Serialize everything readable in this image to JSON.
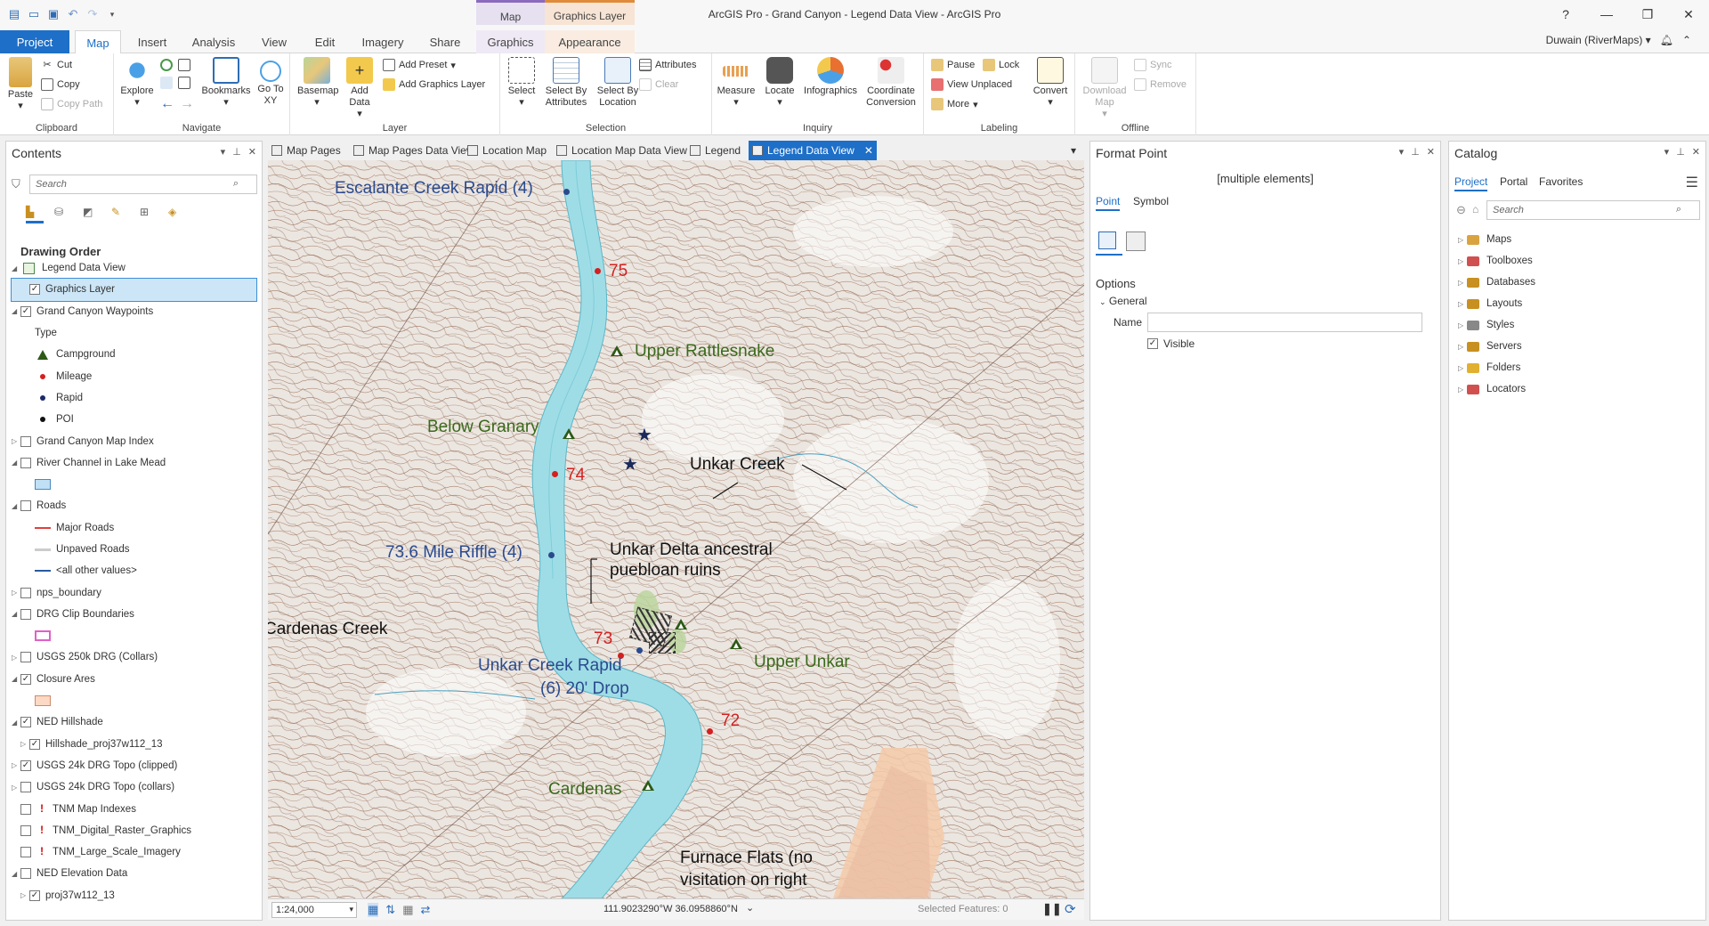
{
  "window": {
    "title": "ArcGIS Pro - Grand Canyon - Legend Data View - ArcGIS Pro",
    "controls": [
      "?",
      "—",
      "❐",
      "✕"
    ]
  },
  "context_tabs": {
    "map_header": "Map",
    "graphics_layer_header": "Graphics Layer",
    "graphics": "Graphics",
    "appearance": "Appearance"
  },
  "ribbon_tabs": [
    "Project",
    "Map",
    "Insert",
    "Analysis",
    "View",
    "Edit",
    "Imagery",
    "Share"
  ],
  "user": {
    "name": "Duwain (RiverMaps) ▾"
  },
  "ribbon": {
    "clipboard": {
      "label": "Clipboard",
      "paste": "Paste",
      "cut": "Cut",
      "copy": "Copy",
      "copy_path": "Copy Path"
    },
    "navigate": {
      "label": "Navigate",
      "explore": "Explore",
      "bookmarks": "Bookmarks",
      "go_to_xy": "Go To XY"
    },
    "layer": {
      "label": "Layer",
      "basemap": "Basemap",
      "add_data": "Add Data",
      "add_preset": "Add Preset",
      "add_graphics_layer": "Add Graphics Layer"
    },
    "selection": {
      "label": "Selection",
      "select": "Select",
      "select_by_attributes": "Select By Attributes",
      "select_by_location": "Select By Location",
      "attributes": "Attributes",
      "clear": "Clear"
    },
    "inquiry": {
      "label": "Inquiry",
      "measure": "Measure",
      "locate": "Locate",
      "infographics": "Infographics",
      "coordinate_conversion": "Coordinate Conversion"
    },
    "labeling": {
      "label": "Labeling",
      "pause": "Pause",
      "lock": "Lock",
      "view_unplaced": "View Unplaced",
      "more": "More",
      "convert": "Convert"
    },
    "offline": {
      "label": "Offline",
      "download_map": "Download Map",
      "sync": "Sync",
      "remove": "Remove"
    }
  },
  "contents": {
    "title": "Contents",
    "search_placeholder": "Search",
    "drawing_order": "Drawing Order",
    "items": [
      {
        "label": "Legend Data View",
        "kind": "map",
        "exp": "◢"
      },
      {
        "label": "Graphics Layer",
        "kind": "layer",
        "checked": true,
        "selected": true,
        "indent": 1
      },
      {
        "label": "Grand Canyon Waypoints",
        "kind": "layer",
        "checked": true,
        "exp": "◢",
        "indent": 0
      },
      {
        "label": "Type",
        "kind": "heading",
        "indent": 1
      },
      {
        "label": "Campground",
        "kind": "sym-camp",
        "indent": 1
      },
      {
        "label": "Mileage",
        "kind": "sym-red",
        "indent": 1
      },
      {
        "label": "Rapid",
        "kind": "sym-navy",
        "indent": 1
      },
      {
        "label": "POI",
        "kind": "sym-black",
        "indent": 1
      },
      {
        "label": "Grand Canyon Map Index",
        "kind": "layer",
        "checked": false,
        "exp": "▷"
      },
      {
        "label": "River Channel in Lake Mead",
        "kind": "layer",
        "checked": false,
        "exp": "◢"
      },
      {
        "label": "",
        "kind": "sym-box-blue",
        "indent": 1
      },
      {
        "label": "Roads",
        "kind": "layer",
        "checked": false,
        "exp": "◢"
      },
      {
        "label": "Major Roads",
        "kind": "sym-line-red",
        "indent": 1
      },
      {
        "label": "Unpaved Roads",
        "kind": "sym-line-grey",
        "indent": 1
      },
      {
        "label": "<all other values>",
        "kind": "sym-line-blue",
        "indent": 1
      },
      {
        "label": "nps_boundary",
        "kind": "layer",
        "checked": false,
        "exp": "▷"
      },
      {
        "label": "DRG Clip Boundaries",
        "kind": "layer",
        "checked": false,
        "exp": "◢"
      },
      {
        "label": "",
        "kind": "sym-box-pink",
        "indent": 1
      },
      {
        "label": "USGS 250k DRG (Collars)",
        "kind": "layer",
        "checked": false,
        "exp": "▷"
      },
      {
        "label": "Closure Ares",
        "kind": "layer",
        "checked": true,
        "exp": "◢"
      },
      {
        "label": "",
        "kind": "sym-box-peach",
        "indent": 1
      },
      {
        "label": "NED Hillshade",
        "kind": "layer",
        "checked": true,
        "exp": "◢"
      },
      {
        "label": "Hillshade_proj37w112_13",
        "kind": "layer",
        "checked": true,
        "exp": "▷",
        "indent": 1
      },
      {
        "label": "USGS 24k DRG Topo (clipped)",
        "kind": "layer",
        "checked": true,
        "exp": "▷"
      },
      {
        "label": "USGS 24k DRG Topo (collars)",
        "kind": "layer",
        "checked": false,
        "exp": "▷"
      },
      {
        "label": "TNM Map Indexes",
        "kind": "warn",
        "checked": false
      },
      {
        "label": "TNM_Digital_Raster_Graphics",
        "kind": "warn",
        "checked": false
      },
      {
        "label": "TNM_Large_Scale_Imagery",
        "kind": "warn",
        "checked": false
      },
      {
        "label": "NED Elevation Data",
        "kind": "layer",
        "checked": false,
        "exp": "◢"
      },
      {
        "label": "proj37w112_13",
        "kind": "layer",
        "checked": true,
        "exp": "▷",
        "indent": 1
      }
    ]
  },
  "map_tabs": [
    {
      "label": "Map Pages"
    },
    {
      "label": "Map Pages Data View"
    },
    {
      "label": "Location Map"
    },
    {
      "label": "Location Map Data View"
    },
    {
      "label": "Legend"
    },
    {
      "label": "Legend Data View",
      "active": true
    }
  ],
  "map_labels": {
    "escalante": "Escalante Creek Rapid (4)",
    "m75": "75",
    "upper_rattlesnake": "Upper Rattlesnake",
    "below_granary": "Below Granary",
    "m74": "74",
    "unkar_creek": "Unkar Creek",
    "riffle": "73.6 Mile Riffle (4)",
    "unkar_delta_1": "Unkar Delta ancestral",
    "unkar_delta_2": "puebloan ruins",
    "cardenas_creek": "Cardenas Creek",
    "m73": "73",
    "unkar_rapid_1": "Unkar Creek Rapid",
    "unkar_rapid_2": "(6) 20' Drop",
    "upper_unkar": "Upper Unkar",
    "m72": "72",
    "cardenas": "Cardenas",
    "furnace_1": "Furnace Flats (no",
    "furnace_2": "visitation on right"
  },
  "status": {
    "scale": "1:24,000",
    "coords": "111.9023290°W 36.0958860°N",
    "selected": "Selected Features: 0"
  },
  "format_point": {
    "title": "Format Point",
    "subtitle": "[multiple elements]",
    "tab_point": "Point",
    "tab_symbol": "Symbol",
    "options": "Options",
    "general": "General",
    "name_label": "Name",
    "name_value": "",
    "visible": "Visible"
  },
  "catalog": {
    "title": "Catalog",
    "tabs": [
      "Project",
      "Portal",
      "Favorites"
    ],
    "search_placeholder": "Search",
    "items": [
      "Maps",
      "Toolboxes",
      "Databases",
      "Layouts",
      "Styles",
      "Servers",
      "Folders",
      "Locators"
    ]
  },
  "colors": {
    "accent": "#1e6fc7",
    "river": "#9fdde6",
    "mileage": "#d42020",
    "rapid": "#2a4a8e",
    "camp": "#2d5a16"
  }
}
